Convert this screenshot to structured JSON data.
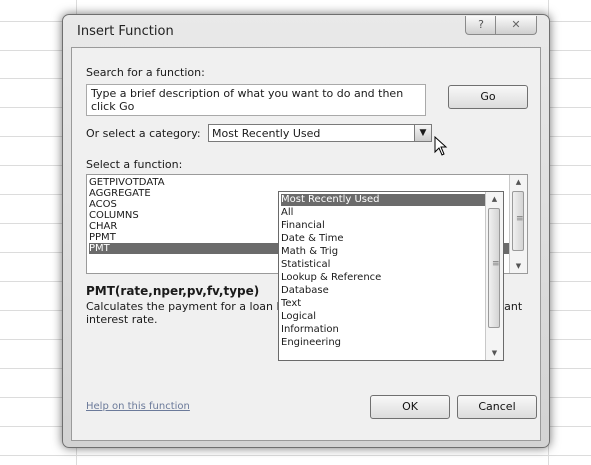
{
  "window": {
    "title": "Insert Function",
    "help_button": "?",
    "close_button": "✕"
  },
  "search": {
    "label": "Search for a function:",
    "value": "Type a brief description of what you want to do and then click Go",
    "go_button": "Go"
  },
  "category": {
    "label": "Or select a category:",
    "selected": "Most Recently Used",
    "arrow": "▼",
    "options": [
      "Most Recently Used",
      "All",
      "Financial",
      "Date & Time",
      "Math & Trig",
      "Statistical",
      "Lookup & Reference",
      "Database",
      "Text",
      "Logical",
      "Information",
      "Engineering"
    ],
    "highlighted_index": 0
  },
  "functions": {
    "label": "Select a function:",
    "items": [
      "GETPIVOTDATA",
      "AGGREGATE",
      "ACOS",
      "COLUMNS",
      "CHAR",
      "PPMT",
      "PMT"
    ],
    "selected_index": 6
  },
  "details": {
    "syntax": "PMT(rate,nper,pv,fv,type)",
    "description": "Calculates the payment for a loan based on constant payments and a constant interest rate."
  },
  "footer": {
    "help_link": "Help on this function",
    "ok_button": "OK",
    "cancel_button": "Cancel"
  },
  "scroll_glyphs": {
    "up": "▲",
    "down": "▼",
    "grip": "≡"
  }
}
